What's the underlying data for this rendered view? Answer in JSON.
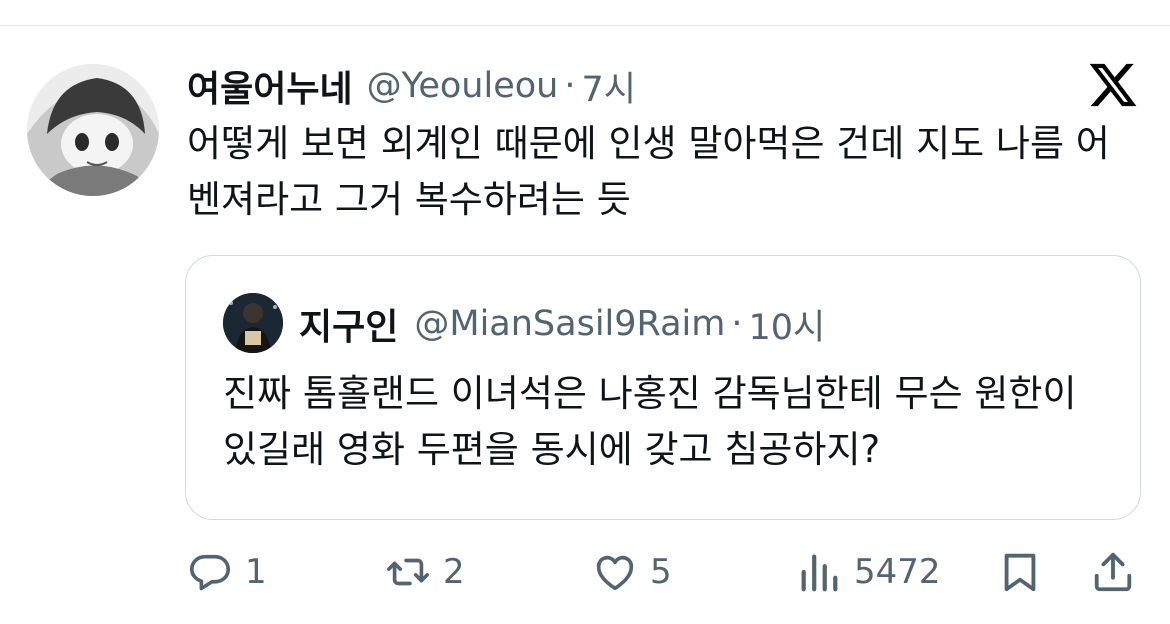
{
  "post": {
    "display_name": "여울어누네",
    "handle": "@Yeouleou",
    "separator": "·",
    "time": "7시",
    "text": "어떻게 보면 외계인 때문에 인생 말아먹은 건데 지도 나름 어벤져라고 그거 복수하려는 듯"
  },
  "quoted": {
    "display_name": "지구인",
    "handle": "@MianSasil9Raim",
    "separator": "·",
    "time": "10시",
    "text": "진짜 톰홀랜드 이녀석은 나홍진 감독님한테 무슨 원한이 있길래 영화 두편을 동시에 갖고 침공하지?"
  },
  "actions": {
    "replies": "1",
    "reposts": "2",
    "likes": "5",
    "views": "5472"
  },
  "icons": {
    "platform": "x-logo-icon",
    "reply": "reply-icon",
    "repost": "repost-icon",
    "like": "heart-icon",
    "views": "views-icon",
    "bookmark": "bookmark-icon",
    "share": "share-icon"
  },
  "colors": {
    "text": "#0f1419",
    "secondary": "#536471",
    "border": "#cfd9de"
  }
}
